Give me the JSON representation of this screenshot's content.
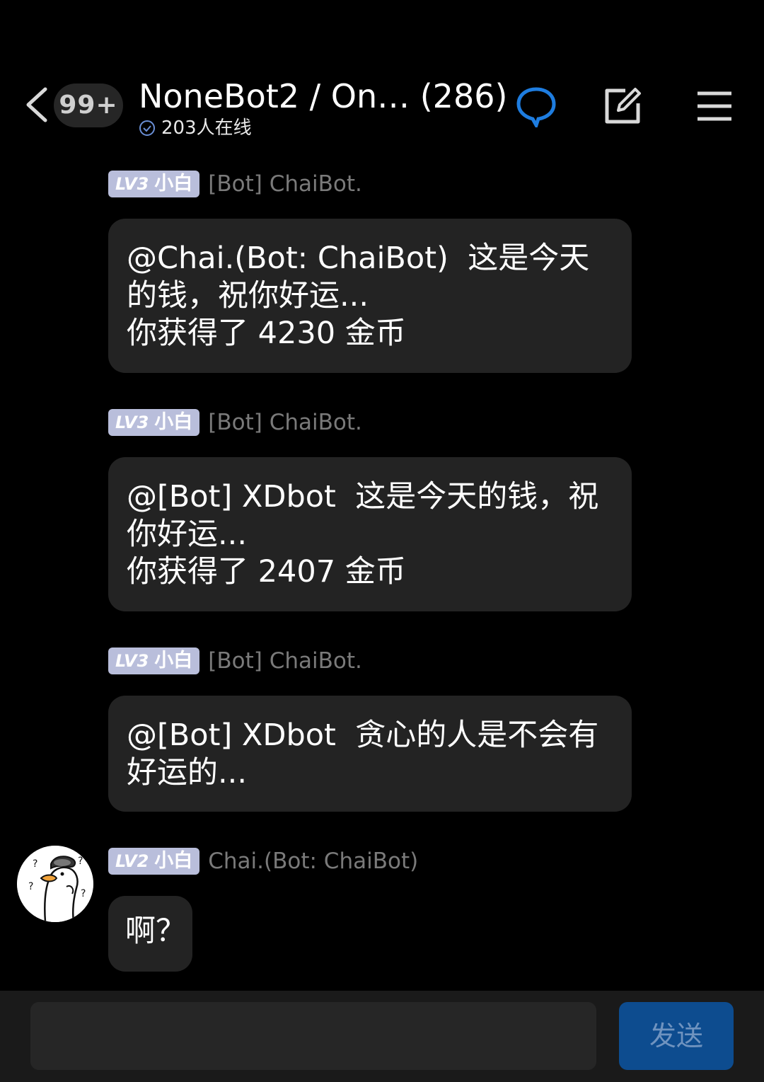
{
  "header": {
    "unread_count": "99+",
    "group_title": "NoneBot2 / On…  (286)",
    "online_text": "203人在线"
  },
  "colors": {
    "background": "#000000",
    "bubble": "#232323",
    "level_badge": "#b9bedb",
    "accent": "#1e7de0",
    "send_button": "#0d4c8f"
  },
  "messages": [
    {
      "level": "LV3",
      "title": "小白",
      "sender": "[Bot] ChaiBot.",
      "text": "@Chai.(Bot: ChaiBot)  这是今天\n的钱，祝你好运...\n你获得了 4230 金币"
    },
    {
      "level": "LV3",
      "title": "小白",
      "sender": "[Bot] ChaiBot.",
      "text": "@[Bot] XDbot  这是今天的钱，祝\n你好运...\n你获得了 2407 金币"
    },
    {
      "level": "LV3",
      "title": "小白",
      "sender": "[Bot] ChaiBot.",
      "text": "@[Bot] XDbot  贪心的人是不会有\n好运的..."
    },
    {
      "level": "LV2",
      "title": "小白",
      "sender": "Chai.(Bot: ChaiBot)",
      "text": "啊？"
    }
  ],
  "input": {
    "value": "",
    "placeholder": "",
    "send_label": "发送"
  },
  "icons": {
    "back": "chevron-left-icon",
    "chat": "chat-bubble-icon",
    "edit": "edit-icon",
    "menu": "menu-icon",
    "verified": "check-circle-icon",
    "avatar": "duck-avatar"
  }
}
